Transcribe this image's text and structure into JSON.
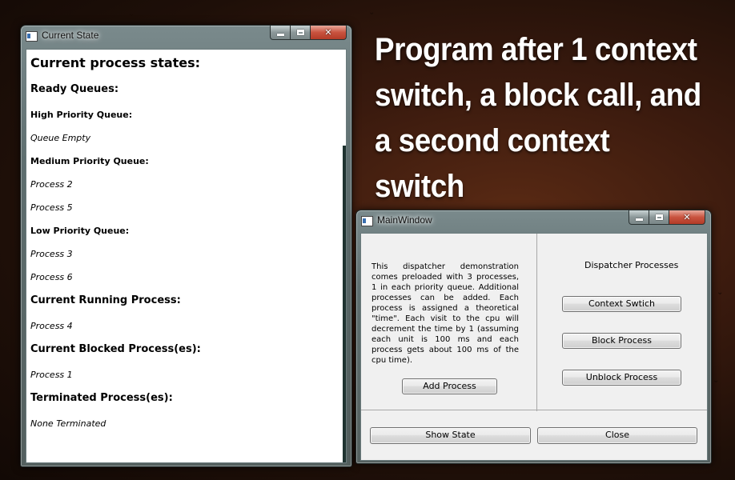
{
  "caption": "Program after 1 context switch, a block call, and a second context switch",
  "state_window": {
    "title": "Current State",
    "heading": "Current process states:",
    "ready_heading": "Ready Queues:",
    "high_heading": "High Priority Queue:",
    "high_items": [
      "Queue Empty"
    ],
    "medium_heading": "Medium Priority Queue:",
    "medium_items": [
      "Process 2",
      "Process 5"
    ],
    "low_heading": "Low Priority Queue:",
    "low_items": [
      "Process 3",
      "Process 6"
    ],
    "running_heading": "Current Running Process:",
    "running_items": [
      "Process 4"
    ],
    "blocked_heading": "Current Blocked Process(es):",
    "blocked_items": [
      "Process 1"
    ],
    "terminated_heading": "Terminated Process(es):",
    "terminated_items": [
      "None Terminated"
    ]
  },
  "main_window": {
    "title": "MainWindow",
    "description": "This dispatcher demonstration comes preloaded with 3 processes, 1 in each priority queue. Additional processes can be added. Each process is assigned a theoretical \"time\". Each visit to the cpu will decrement the time by 1 (assuming each unit is 100 ms and each process gets about 100 ms of the cpu time).",
    "dispatcher_label": "Dispatcher Processes",
    "buttons": {
      "add_process": "Add Process",
      "context_switch": "Context Swtich",
      "block_process": "Block Process",
      "unblock_process": "Unblock Process",
      "show_state": "Show State",
      "close": "Close"
    }
  }
}
